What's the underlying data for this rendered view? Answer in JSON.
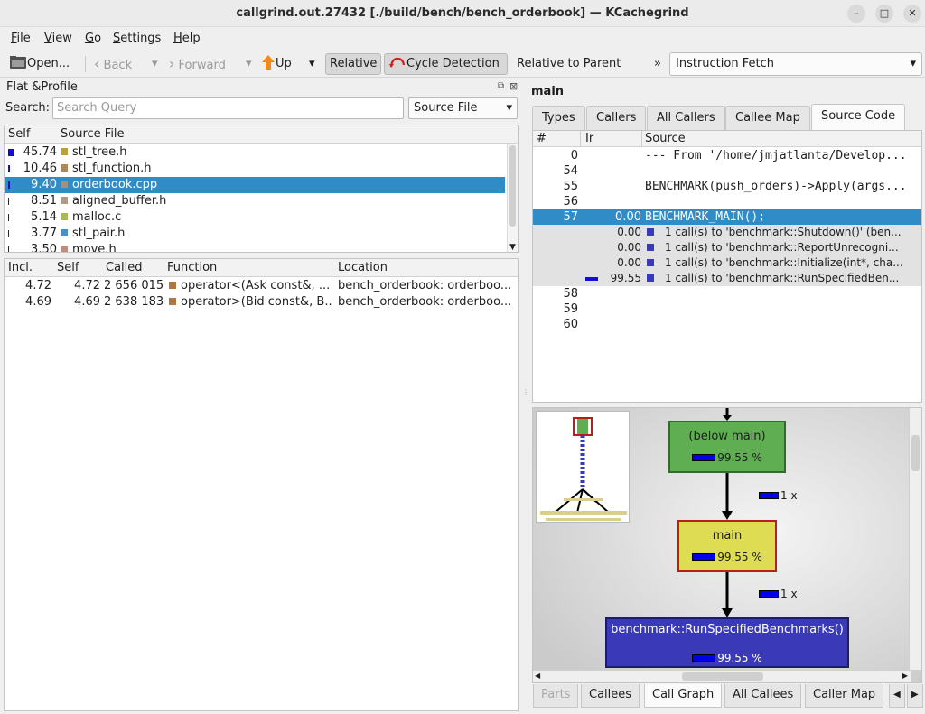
{
  "window": {
    "title": "callgrind.out.27432 [./build/bench/bench_orderbook] — KCachegrind",
    "controls": [
      "–",
      "□",
      "✕"
    ]
  },
  "menu": [
    {
      "u": "F",
      "rest": "ile"
    },
    {
      "u": "V",
      "rest": "iew"
    },
    {
      "u": "G",
      "rest": "o"
    },
    {
      "u": "S",
      "rest": "ettings"
    },
    {
      "u": "H",
      "rest": "elp"
    }
  ],
  "toolbar": {
    "open": "Open...",
    "back": "Back",
    "forward": "Forward",
    "up": "Up",
    "relative": "Relative",
    "cycle_detection": "Cycle Detection",
    "relative_to_parent": "Relative to Parent",
    "overflow": "»",
    "event_type": "Instruction Fetch"
  },
  "left": {
    "title": "Flat &Profile",
    "search_label": "Search:",
    "search_placeholder": "Search Query",
    "group_by": "Source File",
    "group_headers": [
      "Self",
      "Source File"
    ],
    "groups": [
      {
        "self": "45.74",
        "name": "stl_tree.h",
        "color": "#b8a23a",
        "pct": 45.74
      },
      {
        "self": "10.46",
        "name": "stl_function.h",
        "color": "#b08858",
        "pct": 10.46
      },
      {
        "self": "9.40",
        "name": "orderbook.cpp",
        "color": "#a09080",
        "pct": 9.4
      },
      {
        "self": "8.51",
        "name": "aligned_buffer.h",
        "color": "#b09a84",
        "pct": 8.51
      },
      {
        "self": "5.14",
        "name": "malloc.c",
        "color": "#a9b85a",
        "pct": 5.14
      },
      {
        "self": "3.77",
        "name": "stl_pair.h",
        "color": "#4a90c8",
        "pct": 3.77
      },
      {
        "self": "3.50",
        "name": "move.h",
        "color": "#c08c80",
        "pct": 3.5
      }
    ],
    "func_headers": [
      "Incl.",
      "Self",
      "Called",
      "Function",
      "Location"
    ],
    "functions": [
      {
        "incl": "4.72",
        "self": "4.72",
        "called": "2 656 015",
        "name": "operator<(Ask const&, ...",
        "color": "#b07840",
        "location": "bench_orderbook: orderboo..."
      },
      {
        "incl": "4.69",
        "self": "4.69",
        "called": "2 638 183",
        "name": "operator>(Bid const&, B...",
        "color": "#b07840",
        "location": "bench_orderbook: orderboo..."
      }
    ]
  },
  "right": {
    "function_name": "main",
    "tabs": [
      "Types",
      "Callers",
      "All Callers",
      "Callee Map",
      "Source Code"
    ],
    "source_headers": [
      "#",
      "Ir",
      "Source"
    ],
    "source_rows": [
      {
        "ln": "0",
        "ir": "",
        "text": "--- From '/home/jmjatlanta/Develop..."
      },
      {
        "ln": "54",
        "ir": "",
        "text": ""
      },
      {
        "ln": "55",
        "ir": "",
        "text": "BENCHMARK(push_orders)->Apply(args..."
      },
      {
        "ln": "56",
        "ir": "",
        "text": ""
      },
      {
        "ln": "57",
        "ir": "0.00",
        "text": "BENCHMARK_MAIN();"
      }
    ],
    "call_rows": [
      {
        "ir": "0.00",
        "text": "1 call(s) to 'benchmark::Shutdown()' (ben..."
      },
      {
        "ir": "0.00",
        "text": "1 call(s) to 'benchmark::ReportUnrecogni..."
      },
      {
        "ir": "0.00",
        "text": "1 call(s) to 'benchmark::Initialize(int*, cha..."
      },
      {
        "ir": "99.55",
        "text": "1 call(s) to 'benchmark::RunSpecifiedBen..."
      }
    ],
    "source_tail": [
      "58",
      "59",
      "60"
    ],
    "graph": {
      "nodes": [
        {
          "label": "(below main)",
          "cost": "99.55 %"
        },
        {
          "label": "main",
          "cost": "99.55 %"
        },
        {
          "label": "benchmark::RunSpecifiedBenchmarks()",
          "cost": "99.55 %"
        }
      ],
      "edges": [
        "1 x",
        "1 x"
      ]
    },
    "bottom_tabs": [
      "Parts",
      "Callees",
      "Call Graph",
      "All Callees",
      "Caller Map"
    ]
  },
  "colors": {
    "selection": "#308cc6",
    "below_main_node": "#5fae52",
    "main_node": "#dedc52",
    "run_node": "#3a3ab8"
  }
}
